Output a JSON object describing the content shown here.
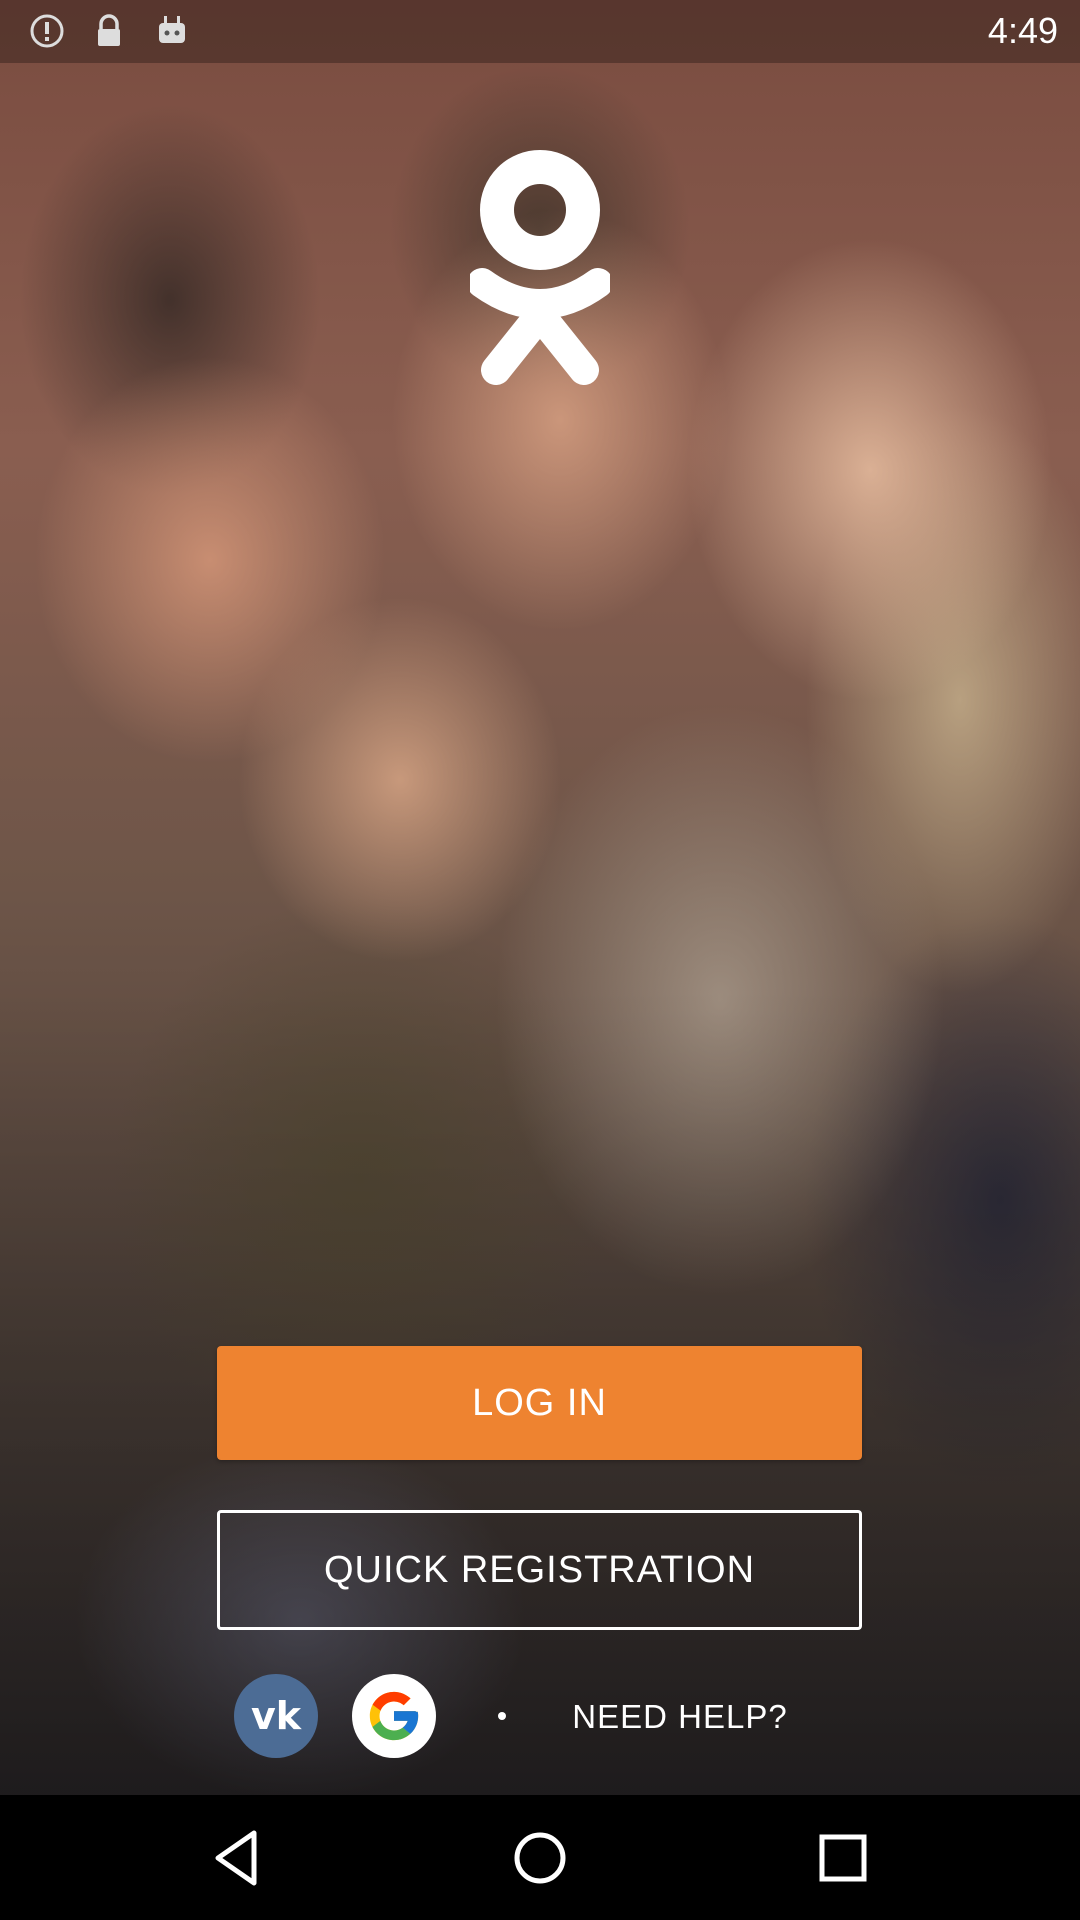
{
  "status_bar": {
    "time": "4:49",
    "icons": [
      "alert-circle-icon",
      "lock-icon",
      "android-robot-icon"
    ]
  },
  "brand": {
    "logo": "ok-logo-icon",
    "logo_color": "#ffffff"
  },
  "actions": {
    "login_label": "LOG IN",
    "login_color": "#ee8330",
    "register_label": "QUICK REGISTRATION",
    "social": [
      {
        "name": "vk-icon",
        "label": "vk",
        "color": "#4c6c95"
      },
      {
        "name": "google-icon",
        "label": "G",
        "color": "#ffffff"
      }
    ],
    "help_label": "NEED HELP?"
  },
  "nav_bar": {
    "buttons": [
      "back-icon",
      "home-icon",
      "recents-icon"
    ]
  }
}
